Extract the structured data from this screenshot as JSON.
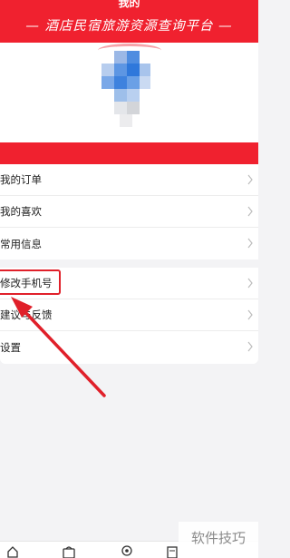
{
  "header": {
    "title": "我的",
    "slogan": "— 酒店民宿旅游资源查询平台 —"
  },
  "menu_group_1": [
    {
      "label": "我的订单"
    },
    {
      "label": "我的喜欢"
    },
    {
      "label": "常用信息"
    }
  ],
  "menu_group_2": [
    {
      "label": "修改手机号"
    },
    {
      "label": "建议与反馈"
    },
    {
      "label": "设置"
    }
  ],
  "watermark": "软件技巧",
  "colors": {
    "accent": "#f0212f",
    "annotation": "#e0202a"
  },
  "icons": [
    "home-icon",
    "bag-icon",
    "location-icon",
    "document-icon",
    "chevron-right-icon"
  ]
}
